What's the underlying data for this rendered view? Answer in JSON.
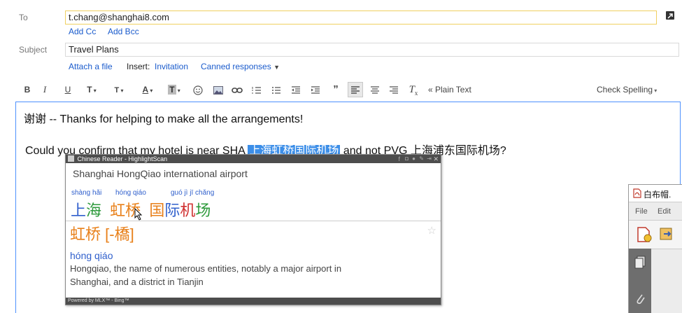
{
  "compose": {
    "to_label": "To",
    "to_value": "t.chang@shanghai8.com",
    "add_cc": "Add Cc",
    "add_bcc": "Add Bcc",
    "subject_label": "Subject",
    "subject_value": "Travel Plans",
    "attach": "Attach a file",
    "insert_label": "Insert:",
    "invitation": "Invitation",
    "canned": "Canned responses",
    "popout_icon": "popout-icon"
  },
  "toolbar": {
    "bold": "B",
    "italic": "I",
    "underline": "U",
    "font": "T",
    "size": "T",
    "text_color": "A",
    "bg_color": "T",
    "plain_text": "« Plain Text",
    "check_spelling": "Check Spelling"
  },
  "body": {
    "line1": "谢谢 -- Thanks for helping to make all the arrangements!",
    "line2_before": "Could you confirm that my hotel is near SHA ",
    "line2_highlight": "上海虹桥国际机场",
    "line2_after": " and not PVG 上海浦东国际机场?"
  },
  "popup": {
    "title": "Chinese Reader - HighlightScan",
    "translation": "Shanghai HongQiao international airport",
    "pinyin": [
      {
        "text": "shàng hǎi"
      },
      {
        "text": "hóng qiáo"
      },
      {
        "text": "guó jì jī chǎng"
      }
    ],
    "chars": [
      {
        "text": "上",
        "color": "#2f5fcc"
      },
      {
        "text": "海",
        "color": "#2e9a3c"
      },
      {
        "text": "虹",
        "color": "#e8801a"
      },
      {
        "text": "桥",
        "color": "#e8801a"
      },
      {
        "text": "国",
        "color": "#e8801a"
      },
      {
        "text": "际",
        "color": "#2f5fcc"
      },
      {
        "text": "机",
        "color": "#d03030"
      },
      {
        "text": "场",
        "color": "#2e9a3c"
      }
    ],
    "entry_head": "虹桥",
    "entry_trad": "[-橋]",
    "entry_pinyin": "hóng qiáo",
    "definition_1": "Hongqiao, the name of numerous entities, notably a major airport in",
    "definition_2": "Shanghai, and a district in Tianjin",
    "footer": "Powered by MLX™ - Bing™"
  },
  "sidewin": {
    "title": "白布帽.",
    "menu_file": "File",
    "menu_edit": "Edit"
  },
  "colors": {
    "link": "#1a5bcc",
    "highlight": "#3c8ee8",
    "orange": "#e8801a",
    "blue": "#2f5fcc",
    "green": "#2e9a3c",
    "red": "#d03030"
  }
}
